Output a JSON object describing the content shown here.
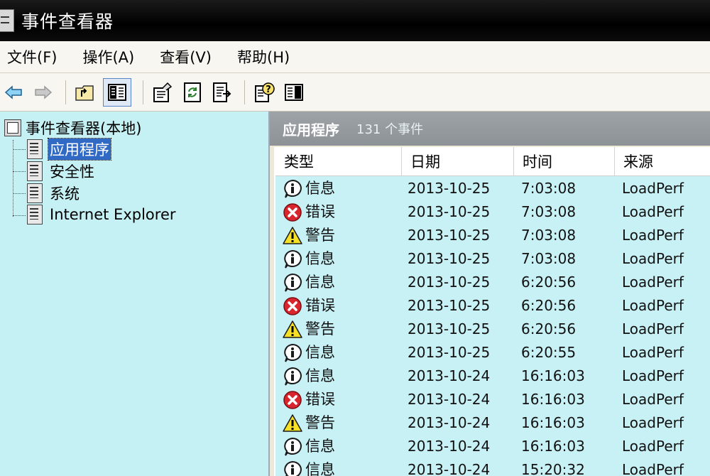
{
  "window": {
    "title": "事件查看器"
  },
  "menu": [
    {
      "label": "文件(F)"
    },
    {
      "label": "操作(A)"
    },
    {
      "label": "查看(V)"
    },
    {
      "label": "帮助(H)"
    }
  ],
  "toolbar": {
    "buttons": [
      {
        "icon": "back-arrow-icon"
      },
      {
        "icon": "forward-arrow-icon"
      },
      {
        "icon": "up-folder-icon"
      },
      {
        "icon": "show-hide-tree-icon",
        "active": true
      },
      {
        "icon": "properties-icon"
      },
      {
        "icon": "refresh-icon"
      },
      {
        "icon": "export-list-icon"
      },
      {
        "icon": "help-icon"
      },
      {
        "icon": "show-hide-action-pane-icon"
      }
    ]
  },
  "tree": {
    "root": {
      "label": "事件查看器(本地)"
    },
    "nodes": [
      {
        "label": "应用程序",
        "selected": true
      },
      {
        "label": "安全性"
      },
      {
        "label": "系统"
      },
      {
        "label": "Internet Explorer"
      }
    ]
  },
  "panel": {
    "name": "应用程序",
    "count_text": "131 个事件"
  },
  "columns": {
    "type": "类型",
    "date": "日期",
    "time": "时间",
    "source": "来源"
  },
  "events": [
    {
      "type": "信息",
      "kind": "info",
      "date": "2013-10-25",
      "time": "7:03:08",
      "source": "LoadPerf"
    },
    {
      "type": "错误",
      "kind": "error",
      "date": "2013-10-25",
      "time": "7:03:08",
      "source": "LoadPerf"
    },
    {
      "type": "警告",
      "kind": "warning",
      "date": "2013-10-25",
      "time": "7:03:08",
      "source": "LoadPerf"
    },
    {
      "type": "信息",
      "kind": "info",
      "date": "2013-10-25",
      "time": "7:03:08",
      "source": "LoadPerf"
    },
    {
      "type": "信息",
      "kind": "info",
      "date": "2013-10-25",
      "time": "6:20:56",
      "source": "LoadPerf"
    },
    {
      "type": "错误",
      "kind": "error",
      "date": "2013-10-25",
      "time": "6:20:56",
      "source": "LoadPerf"
    },
    {
      "type": "警告",
      "kind": "warning",
      "date": "2013-10-25",
      "time": "6:20:56",
      "source": "LoadPerf"
    },
    {
      "type": "信息",
      "kind": "info",
      "date": "2013-10-25",
      "time": "6:20:55",
      "source": "LoadPerf"
    },
    {
      "type": "信息",
      "kind": "info",
      "date": "2013-10-24",
      "time": "16:16:03",
      "source": "LoadPerf"
    },
    {
      "type": "错误",
      "kind": "error",
      "date": "2013-10-24",
      "time": "16:16:03",
      "source": "LoadPerf"
    },
    {
      "type": "警告",
      "kind": "warning",
      "date": "2013-10-24",
      "time": "16:16:03",
      "source": "LoadPerf"
    },
    {
      "type": "信息",
      "kind": "info",
      "date": "2013-10-24",
      "time": "16:16:03",
      "source": "LoadPerf"
    },
    {
      "type": "信息",
      "kind": "info",
      "date": "2013-10-24",
      "time": "15:20:32",
      "source": "LoadPerf"
    }
  ],
  "colors": {
    "title_bar": "#000000",
    "tree_background": "#c5f1f5",
    "list_background": "#c8f1f5",
    "selection": "#316ac5",
    "panel_header": "#969ba0",
    "error": "#d9262e",
    "warning": "#f5e025"
  }
}
